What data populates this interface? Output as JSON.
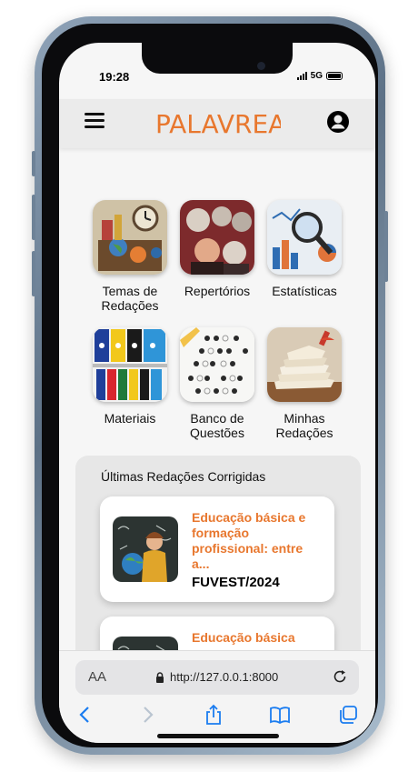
{
  "status": {
    "time": "19:28",
    "network": "5G"
  },
  "app": {
    "logo_text": "PALAVREAR"
  },
  "tiles": [
    {
      "label": "Temas de Redações",
      "icon": "themes-image"
    },
    {
      "label": "Repertórios",
      "icon": "repertoire-image"
    },
    {
      "label": "Estatísticas",
      "icon": "statistics-image"
    },
    {
      "label": "Materiais",
      "icon": "materials-image"
    },
    {
      "label": "Banco de Questões",
      "icon": "question-bank-image"
    },
    {
      "label": "Minhas Redações",
      "icon": "my-essays-image"
    }
  ],
  "recent": {
    "title": "Últimas Redações Corrigidas",
    "cards": [
      {
        "title": "Educação básica e formação profissional: entre a...",
        "exam": "FUVEST/2024"
      },
      {
        "title": "Educação básica",
        "exam": ""
      }
    ]
  },
  "browser": {
    "text_size_label": "AA",
    "url": "http://127.0.0.1:8000"
  },
  "colors": {
    "accent": "#e8772e",
    "appbar": "#ebebeb",
    "background": "#f6f6f6",
    "card": "#ffffff"
  }
}
